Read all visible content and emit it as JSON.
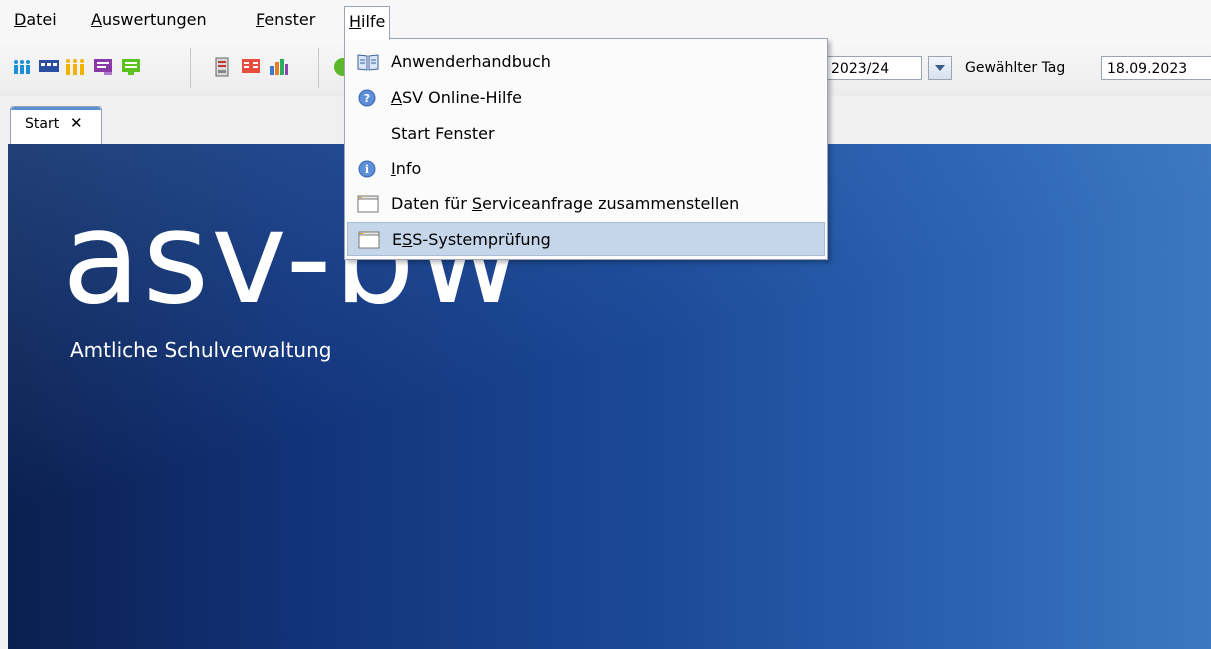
{
  "menubar": {
    "items": [
      {
        "label_u": "D",
        "label_rest": "atei"
      },
      {
        "label_u": "A",
        "label_rest": "uswertungen"
      },
      {
        "label_u": "F",
        "label_rest": "enster"
      },
      {
        "label_u": "H",
        "label_rest": "ilfe"
      }
    ]
  },
  "toolbar": {
    "school_year": "2023/24",
    "day_label": "Gewählter Tag",
    "day_value": "18.09.2023"
  },
  "tabs": [
    {
      "label": "Start",
      "close": "✕"
    }
  ],
  "start_panel": {
    "logo": "asv-bw",
    "subtitle": "Amtliche Schulverwaltung"
  },
  "help_menu": {
    "items": [
      {
        "icon": "book-icon",
        "pre": "",
        "u": "",
        "post": "Anwenderhandbuch"
      },
      {
        "icon": "help-circle-icon",
        "pre": "",
        "u": "A",
        "post": "SV Online-Hilfe"
      },
      {
        "icon": "",
        "pre": "",
        "u": "",
        "post": "Start Fenster"
      },
      {
        "icon": "info-icon",
        "pre": "",
        "u": "I",
        "post": "nfo"
      },
      {
        "icon": "window-icon",
        "pre": "Daten für ",
        "u": "S",
        "post": "erviceanfrage zusammenstellen"
      },
      {
        "icon": "window-icon",
        "pre": "E",
        "u": "S",
        "post": "S-Systemprüfung"
      }
    ],
    "highlighted_index": 5
  },
  "colors": {
    "highlight": "#c5d5ea",
    "panel_dark": "#0b1f4f",
    "panel_light": "#3d77c0"
  }
}
